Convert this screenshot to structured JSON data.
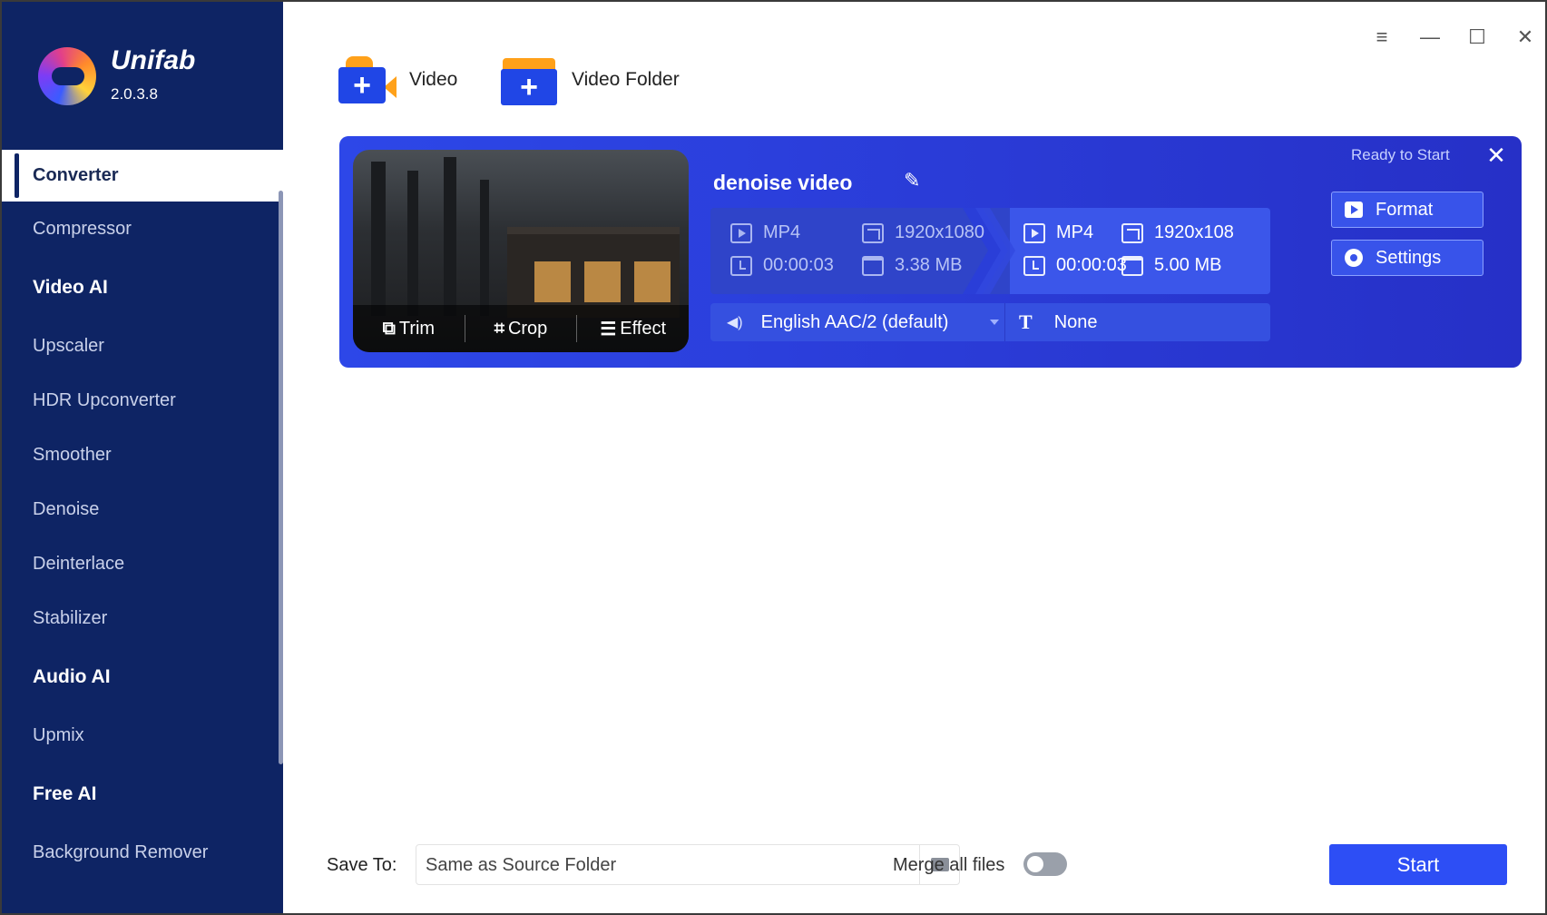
{
  "app": {
    "name": "Unifab",
    "version": "2.0.3.8"
  },
  "sidebar": {
    "items": [
      {
        "label": "Converter",
        "type": "item",
        "active": true
      },
      {
        "label": "Compressor",
        "type": "item"
      },
      {
        "label": "Video AI",
        "type": "section"
      },
      {
        "label": "Upscaler",
        "type": "item"
      },
      {
        "label": "HDR Upconverter",
        "type": "item"
      },
      {
        "label": "Smoother",
        "type": "item"
      },
      {
        "label": "Denoise",
        "type": "item"
      },
      {
        "label": "Deinterlace",
        "type": "item"
      },
      {
        "label": "Stabilizer",
        "type": "item"
      },
      {
        "label": "Audio AI",
        "type": "section"
      },
      {
        "label": "Upmix",
        "type": "item"
      },
      {
        "label": "Free AI",
        "type": "section"
      },
      {
        "label": "Background Remover",
        "type": "item"
      }
    ]
  },
  "toolbar": {
    "add_video_label": "Video",
    "add_folder_label": "Video Folder"
  },
  "window_controls": {
    "menu": "≡",
    "minimize": "—",
    "maximize": "☐",
    "close": "✕"
  },
  "task": {
    "title": "denoise video",
    "status": "Ready to Start",
    "thumbnail_actions": {
      "trim": "Trim",
      "crop": "Crop",
      "effect": "Effect"
    },
    "source": {
      "format": "MP4",
      "resolution": "1920x1080",
      "duration": "00:00:03",
      "size": "3.38 MB"
    },
    "output": {
      "format": "MP4",
      "resolution": "1920x108",
      "duration": "00:00:03",
      "size": "5.00 MB"
    },
    "audio_track": "English AAC/2 (default)",
    "subtitle": "None",
    "format_button": "Format",
    "settings_button": "Settings"
  },
  "footer": {
    "save_to_label": "Save To:",
    "save_to_value": "Same as Source Folder",
    "merge_label": "Merge all files",
    "merge_enabled": false,
    "start_label": "Start"
  },
  "colors": {
    "sidebar_bg": "#0e2464",
    "card_bg": "#2d47e8",
    "accent": "#2d4ef5",
    "folder_orange": "#ffa11a"
  }
}
